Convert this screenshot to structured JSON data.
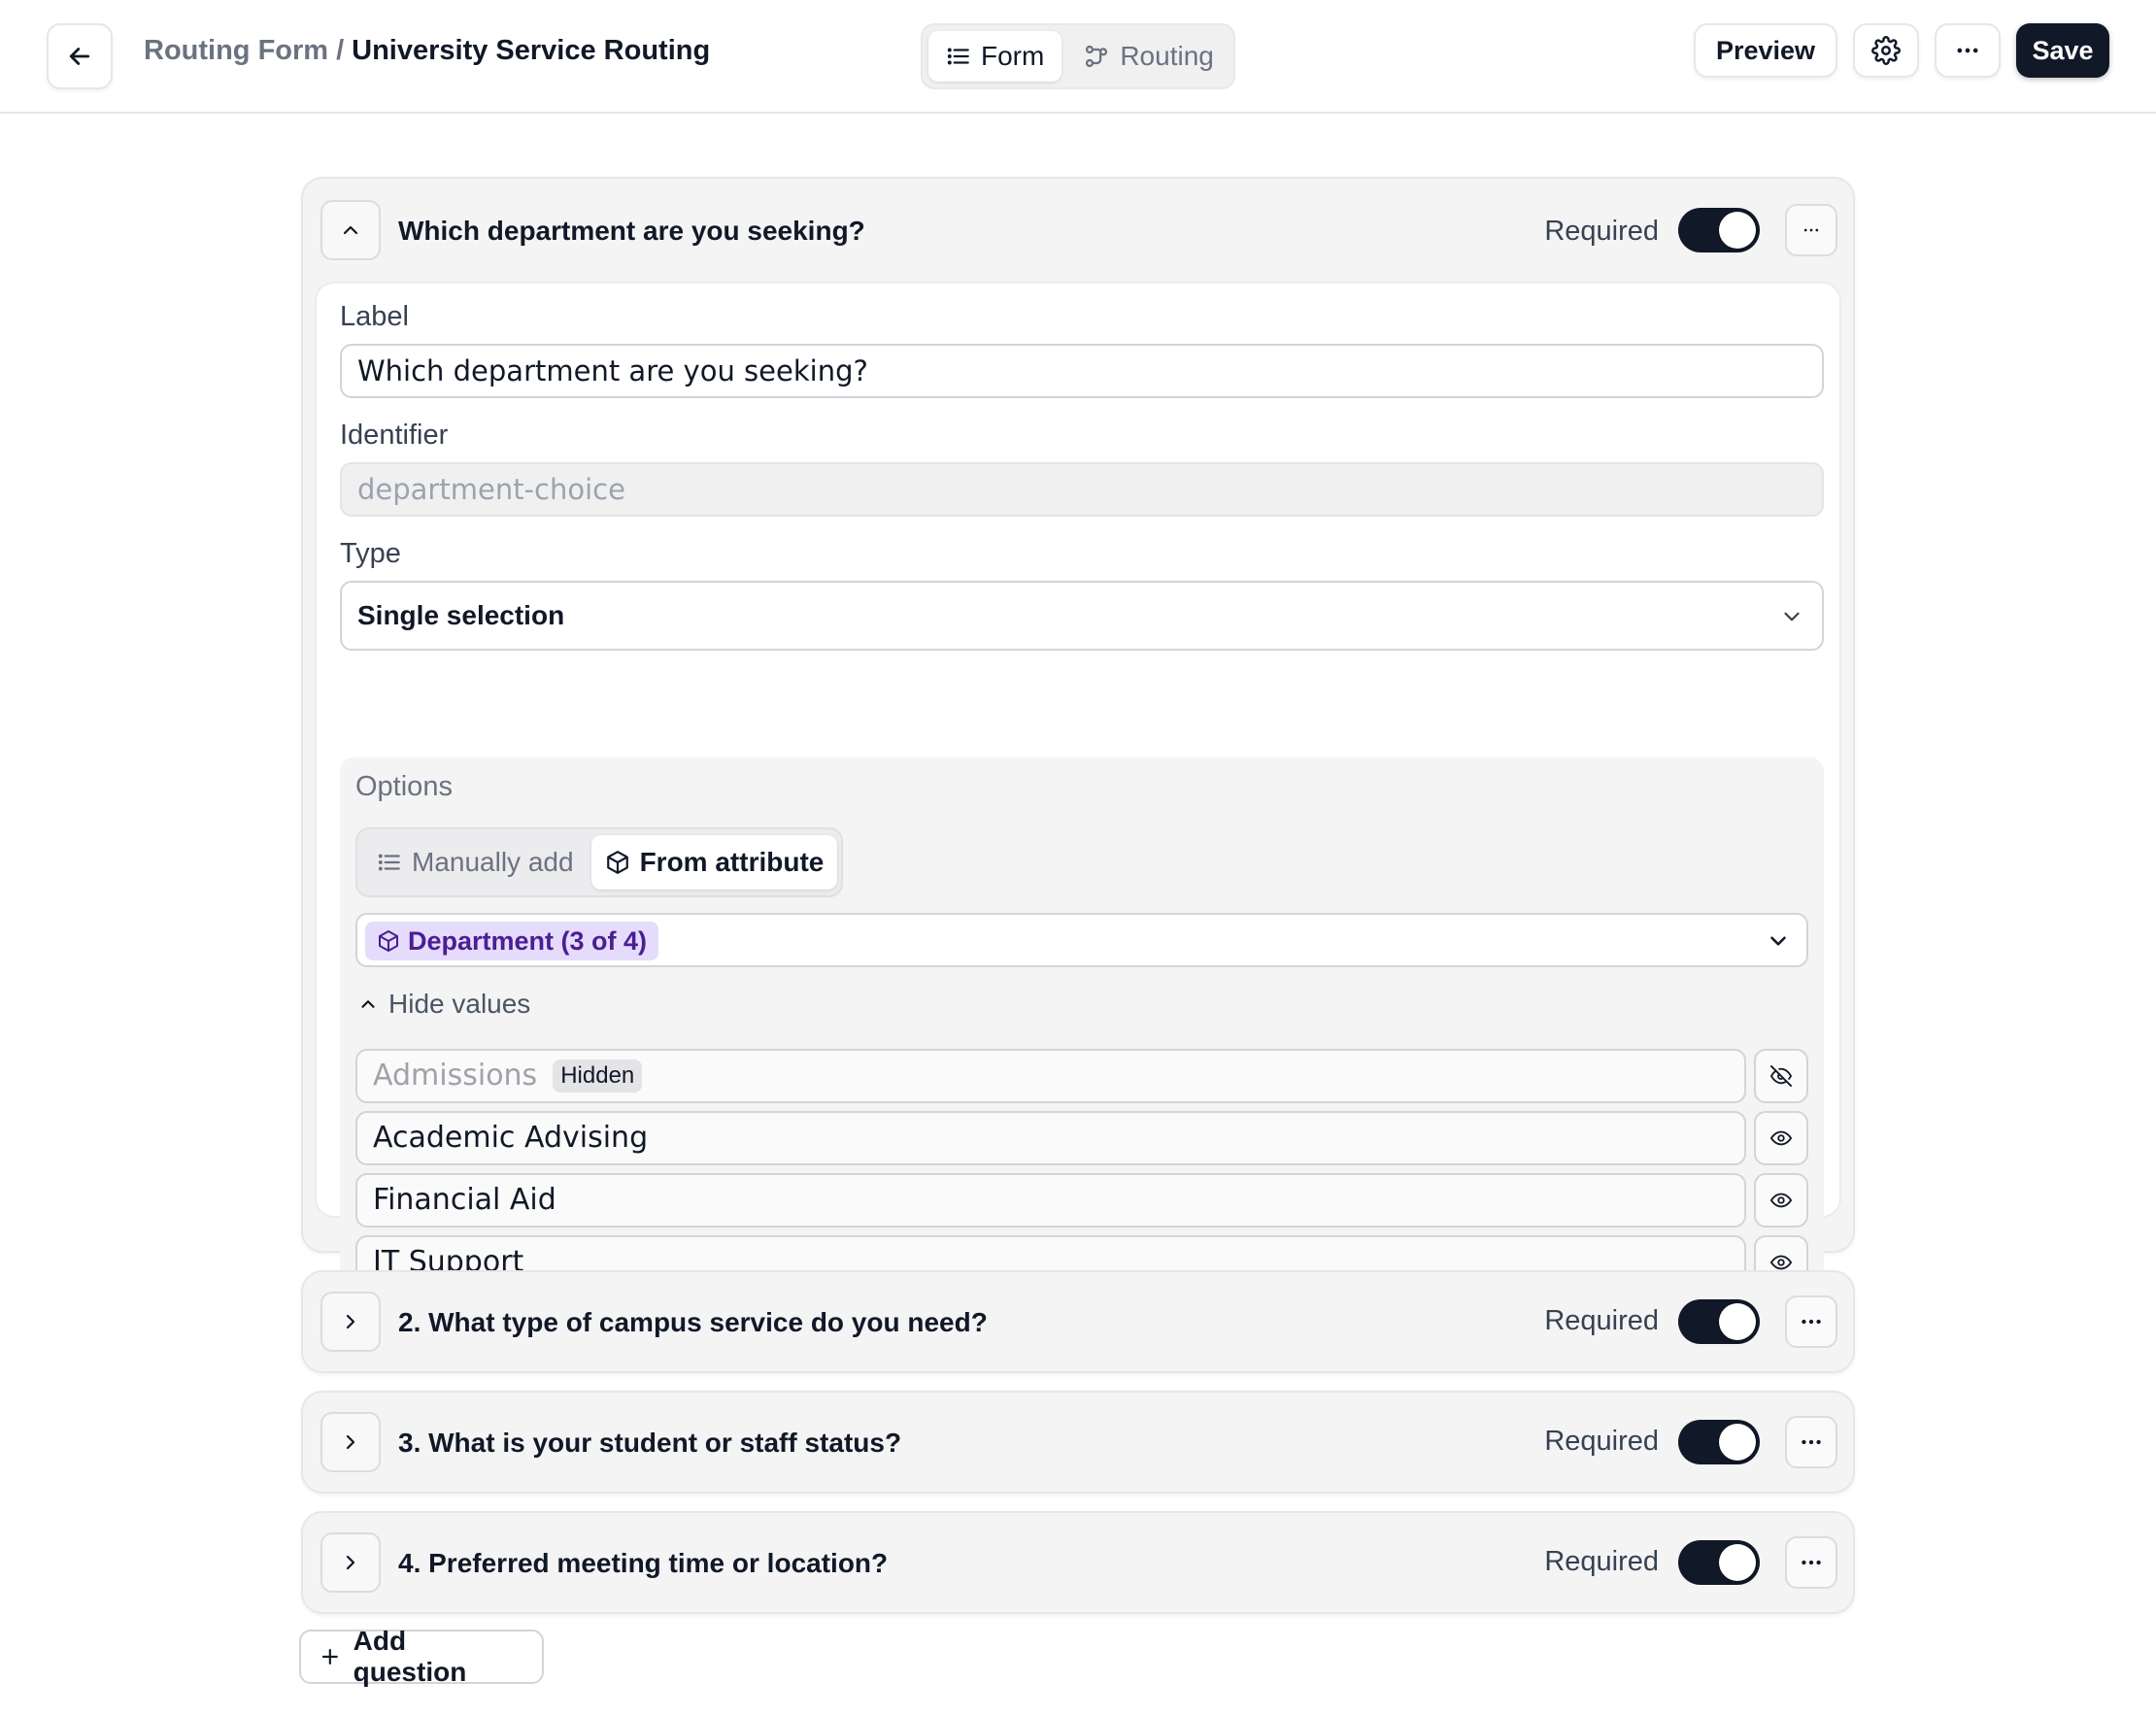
{
  "header": {
    "breadcrumb_parent": "Routing Form",
    "breadcrumb_separator": "/",
    "breadcrumb_current": "University Service Routing",
    "view_tabs": [
      {
        "label": "Form",
        "icon": "list-icon",
        "active": true
      },
      {
        "label": "Routing",
        "icon": "routing-icon",
        "active": false
      }
    ],
    "preview_label": "Preview",
    "save_label": "Save"
  },
  "questions": [
    {
      "title": "Which department are you seeking?",
      "required_label": "Required",
      "required": true,
      "expanded": true,
      "label_field_label": "Label",
      "label_value": "Which department are you seeking?",
      "identifier_field_label": "Identifier",
      "identifier_placeholder": "department-choice",
      "type_field_label": "Type",
      "type_value": "Single selection",
      "options": {
        "title": "Options",
        "source_tabs": [
          {
            "label": "Manually add",
            "icon": "list-icon",
            "active": false
          },
          {
            "label": "From attribute",
            "icon": "cube-icon",
            "active": true
          }
        ],
        "attribute_chip": "Department (3 of 4)",
        "hide_values_label": "Hide values",
        "values": [
          {
            "label": "Admissions",
            "hidden": true,
            "badge": "Hidden"
          },
          {
            "label": "Academic Advising",
            "hidden": false
          },
          {
            "label": "Financial Aid",
            "hidden": false
          },
          {
            "label": "IT Support",
            "hidden": false
          }
        ]
      }
    },
    {
      "title": "2. What type of campus service do you need?",
      "required_label": "Required",
      "required": true,
      "expanded": false
    },
    {
      "title": "3. What is your student or staff status?",
      "required_label": "Required",
      "required": true,
      "expanded": false
    },
    {
      "title": "4. Preferred meeting time or location?",
      "required_label": "Required",
      "required": true,
      "expanded": false
    }
  ],
  "add_question_label": "Add question",
  "colors": {
    "primary_dark": "#111827",
    "attribute_chip_bg": "#e5dcfb",
    "attribute_chip_text": "#4c1d95"
  }
}
